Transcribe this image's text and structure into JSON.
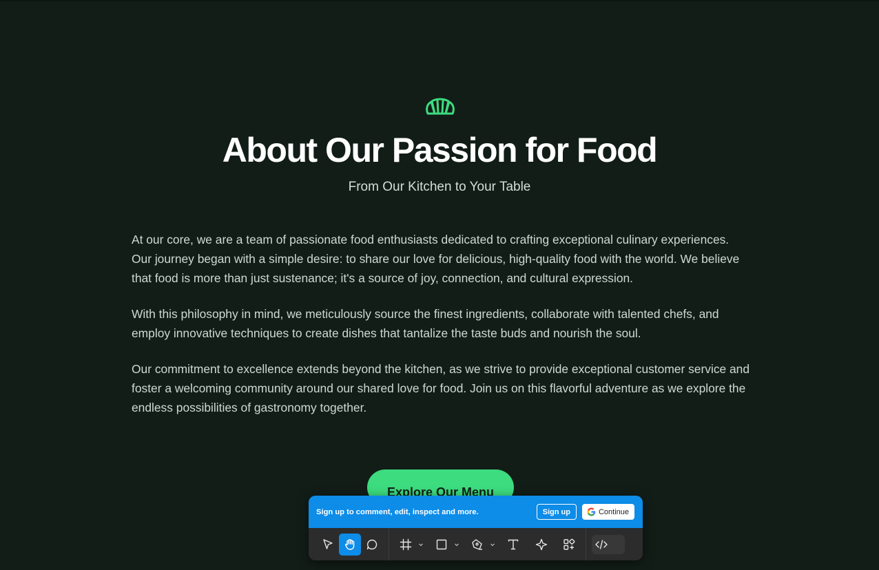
{
  "hero": {
    "title": "About Our Passion for Food",
    "subtitle": "From Our Kitchen to Your Table",
    "paragraphs": [
      "At our core, we are a team of passionate food enthusiasts dedicated to crafting exceptional culinary experiences. Our journey began with a simple desire: to share our love for delicious, high-quality food with the world. We believe that food is more than just sustenance; it's a source of joy, connection, and cultural expression.",
      "With this philosophy in mind, we meticulously source the finest ingredients, collaborate with talented chefs, and employ innovative techniques to create dishes that tantalize the taste buds and nourish the soul.",
      "Our commitment to excellence extends beyond the kitchen, as we strive to provide exceptional customer service and foster a welcoming community around our shared love for food. Join us on this flavorful adventure as we explore the endless possibilities of gastronomy together."
    ],
    "cta_label": "Explore Our Menu",
    "logo_icon": "croissant-icon",
    "accent_color": "#3ddc7f"
  },
  "figma_overlay": {
    "banner_text": "Sign up to comment, edit, inspect and more.",
    "signup_label": "Sign up",
    "continue_label": "Continue",
    "banner_color": "#0d8ce8",
    "tools": [
      "move-icon",
      "hand-icon",
      "comment-icon",
      "frame-icon",
      "rectangle-icon",
      "pen-icon",
      "text-icon",
      "component-icon",
      "plugins-icon",
      "dev-mode-icon"
    ]
  }
}
